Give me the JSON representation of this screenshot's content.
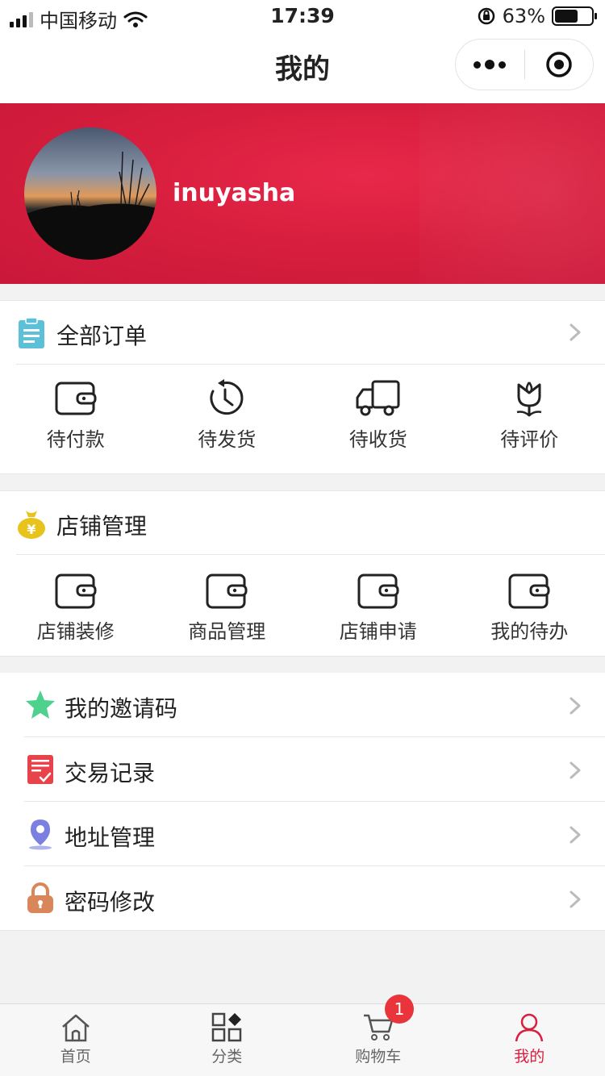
{
  "status_bar": {
    "carrier": "中国移动",
    "time": "17:39",
    "battery_percent": "63%",
    "battery_level": 0.63
  },
  "nav": {
    "title": "我的"
  },
  "profile": {
    "username": "inuyasha"
  },
  "orders": {
    "header": "全部订单",
    "items": [
      {
        "label": "待付款",
        "icon": "wallet-icon"
      },
      {
        "label": "待发货",
        "icon": "clock-icon"
      },
      {
        "label": "待收货",
        "icon": "truck-icon"
      },
      {
        "label": "待评价",
        "icon": "flower-icon"
      }
    ]
  },
  "store": {
    "header": "店铺管理",
    "items": [
      {
        "label": "店铺装修",
        "icon": "wallet-icon"
      },
      {
        "label": "商品管理",
        "icon": "wallet-icon"
      },
      {
        "label": "店铺申请",
        "icon": "wallet-icon"
      },
      {
        "label": "我的待办",
        "icon": "wallet-icon"
      }
    ]
  },
  "menu": [
    {
      "label": "我的邀请码",
      "icon": "star-icon"
    },
    {
      "label": "交易记录",
      "icon": "receipt-icon"
    },
    {
      "label": "地址管理",
      "icon": "location-icon"
    },
    {
      "label": "密码修改",
      "icon": "lock-icon"
    }
  ],
  "tabbar": {
    "items": [
      {
        "label": "首页",
        "icon": "home-icon"
      },
      {
        "label": "分类",
        "icon": "category-icon"
      },
      {
        "label": "购物车",
        "icon": "cart-icon",
        "badge": "1"
      },
      {
        "label": "我的",
        "icon": "user-icon",
        "active": true
      }
    ]
  },
  "colors": {
    "accent": "#d81e3e",
    "badge": "#e8343a",
    "orders_icon": "#5bc0d8",
    "store_icon": "#e8c31c",
    "star_icon": "#4fd18e",
    "receipt_icon": "#e8434a",
    "location_icon": "#7b7fe0",
    "lock_icon": "#d9875a"
  }
}
